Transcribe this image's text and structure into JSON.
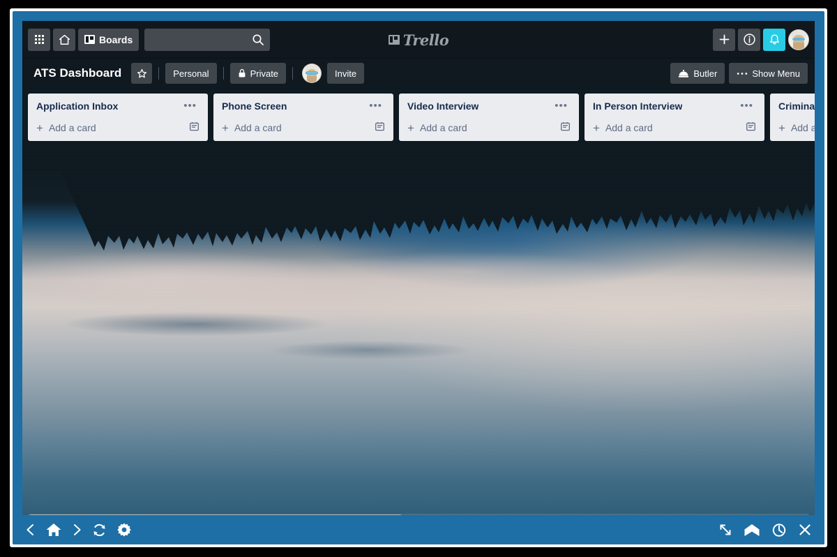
{
  "window": {
    "frame_color": "#1d6fa5",
    "nav_bg": "#10181e",
    "list_bg": "#ebecf0",
    "accent_color": "#29cce5"
  },
  "topnav": {
    "apps_icon": "grid-apps-icon",
    "home_icon": "home-icon",
    "boards_label": "Boards",
    "boards_icon": "boards-icon",
    "search": {
      "value": "",
      "placeholder": "",
      "icon": "search-icon"
    },
    "brand": {
      "name": "Trello",
      "icon": "trello-logo-icon"
    },
    "add_icon": "plus-icon",
    "info_icon": "info-icon",
    "notifications_icon": "bell-icon",
    "avatar_label": "user-avatar"
  },
  "boardbar": {
    "title": "ATS Dashboard",
    "star_icon": "star-icon",
    "workspace_label": "Personal",
    "visibility_label": "Private",
    "visibility_icon": "lock-icon",
    "member_avatar_label": "board-member-avatar",
    "invite_label": "Invite",
    "butler_label": "Butler",
    "butler_icon": "butler-dome-icon",
    "show_menu_label": "Show Menu",
    "show_menu_icon": "ellipsis-icon"
  },
  "board": {
    "lists": [
      {
        "title": "Application Inbox",
        "add_card_label": "Add a card",
        "menu_icon": "ellipsis-icon",
        "template_icon": "card-template-icon"
      },
      {
        "title": "Phone Screen",
        "add_card_label": "Add a card",
        "menu_icon": "ellipsis-icon",
        "template_icon": "card-template-icon"
      },
      {
        "title": "Video Interview",
        "add_card_label": "Add a card",
        "menu_icon": "ellipsis-icon",
        "template_icon": "card-template-icon"
      },
      {
        "title": "In Person Interview",
        "add_card_label": "Add a card",
        "menu_icon": "ellipsis-icon",
        "template_icon": "card-template-icon"
      },
      {
        "title": "Criminal",
        "add_card_label": "Add a card",
        "menu_icon": "ellipsis-icon",
        "template_icon": "card-template-icon"
      }
    ]
  },
  "statusbar": {
    "back_icon": "chevron-left-icon",
    "home_icon": "home-icon",
    "forward_icon": "chevron-right-icon",
    "refresh_icon": "refresh-icon",
    "settings_icon": "gear-icon",
    "resize_icon": "resize-diagonal-icon",
    "mail_icon": "envelope-icon",
    "history_icon": "history-clock-icon",
    "close_icon": "close-x-icon"
  }
}
